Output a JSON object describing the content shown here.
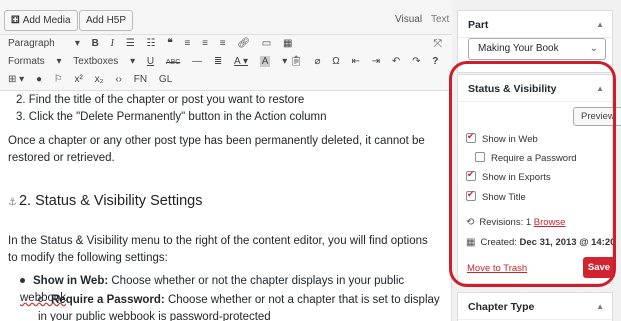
{
  "editor": {
    "add_media": "Add Media",
    "add_h5p": "Add H5P",
    "tab_visual": "Visual",
    "tab_text": "Text",
    "toolbar": {
      "paragraph": "Paragraph",
      "formats": "Formats",
      "textboxes": "Textboxes",
      "fn": "FN",
      "gl": "GL"
    }
  },
  "content": {
    "step2": "2. Find the title of the chapter or post you want to restore",
    "step3": "3. Click the \"Delete Permanently\" button in the Action column",
    "para1": "Once a chapter or any other post type has been permanently deleted, it cannot be restored or retrieved.",
    "heading": "2. Status & Visibility Settings",
    "para2": "In the Status & Visibility menu to the right of the content editor, you will find options to modify the following settings:",
    "bullet1_bold": "Show in Web:",
    "bullet1_text": " Choose whether or not the chapter displays in your public ",
    "bullet1_link": "webbook",
    "sub1_bold": "Require a Password:",
    "sub1_text": " Choose whether or not a chapter that is set to display in your public ",
    "sub1_link": "webbook",
    "sub1_end": " is password-protected"
  },
  "sidebar": {
    "part": {
      "title": "Part",
      "selected": "Making Your Book"
    },
    "status": {
      "title": "Status & Visibility",
      "preview": "Preview",
      "show_in_web": "Show in Web",
      "require_password": "Require a Password",
      "show_in_exports": "Show in Exports",
      "show_title": "Show Title",
      "revisions_label": "Revisions: 1",
      "browse": "Browse",
      "created_label": "Created:",
      "created_value": "Dec 31, 2013 @ 14:20",
      "move_to_trash": "Move to Trash",
      "save": "Save"
    },
    "chapter_type": {
      "title": "Chapter Type"
    }
  },
  "colors": {
    "accent": "#d02531",
    "highlight": "#d01d2b"
  }
}
